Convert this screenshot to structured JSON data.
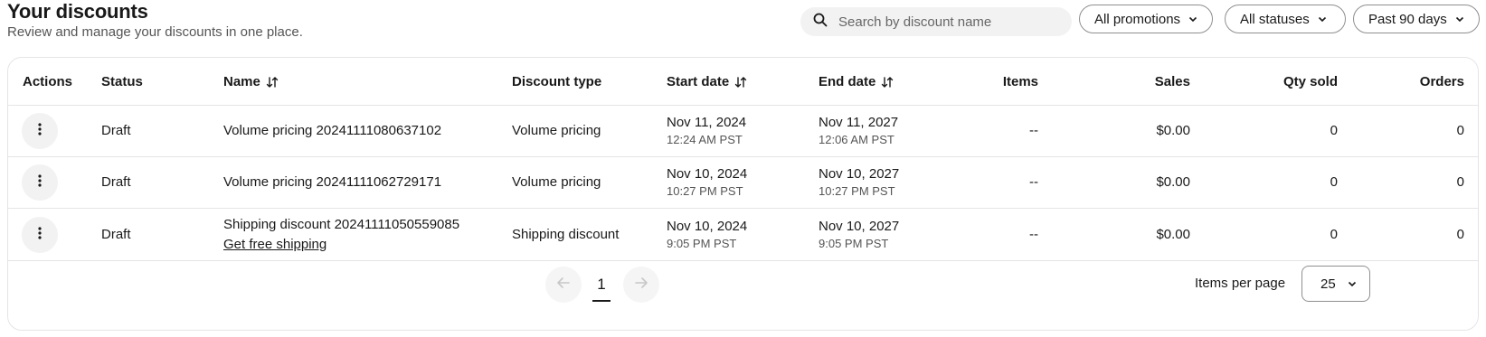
{
  "header": {
    "title": "Your discounts",
    "subtitle": "Review and manage your discounts in one place."
  },
  "search": {
    "placeholder": "Search by discount name",
    "value": ""
  },
  "filters": {
    "promotions": "All promotions",
    "statuses": "All statuses",
    "date_range": "Past 90 days"
  },
  "table": {
    "columns": [
      "Actions",
      "Status",
      "Name",
      "Discount type",
      "Start date",
      "End date",
      "Items",
      "Sales",
      "Qty sold",
      "Orders"
    ],
    "rows": [
      {
        "status": "Draft",
        "name": "Volume pricing 20241111080637102",
        "link": "",
        "type": "Volume pricing",
        "start_date": "Nov 11, 2024",
        "start_time": "12:24 AM PST",
        "end_date": "Nov 11, 2027",
        "end_time": "12:06 AM PST",
        "items": "--",
        "sales": "$0.00",
        "qty_sold": "0",
        "orders": "0"
      },
      {
        "status": "Draft",
        "name": "Volume pricing 20241111062729171",
        "link": "",
        "type": "Volume pricing",
        "start_date": "Nov 10, 2024",
        "start_time": "10:27 PM PST",
        "end_date": "Nov 10, 2027",
        "end_time": "10:27 PM PST",
        "items": "--",
        "sales": "$0.00",
        "qty_sold": "0",
        "orders": "0"
      },
      {
        "status": "Draft",
        "name": "Shipping discount 20241111050559085",
        "link": "Get free shipping",
        "type": "Shipping discount",
        "start_date": "Nov 10, 2024",
        "start_time": "9:05 PM PST",
        "end_date": "Nov 10, 2027",
        "end_time": "9:05 PM PST",
        "items": "--",
        "sales": "$0.00",
        "qty_sold": "0",
        "orders": "0"
      }
    ]
  },
  "pagination": {
    "current_page": "1",
    "items_per_page_label": "Items per page",
    "items_per_page": "25"
  },
  "icons": {
    "search": "search-icon",
    "chevron": "chevron-down-icon",
    "sort": "sort-icon",
    "more": "more-vertical-icon",
    "prev": "arrow-left-icon",
    "next": "arrow-right-icon"
  }
}
